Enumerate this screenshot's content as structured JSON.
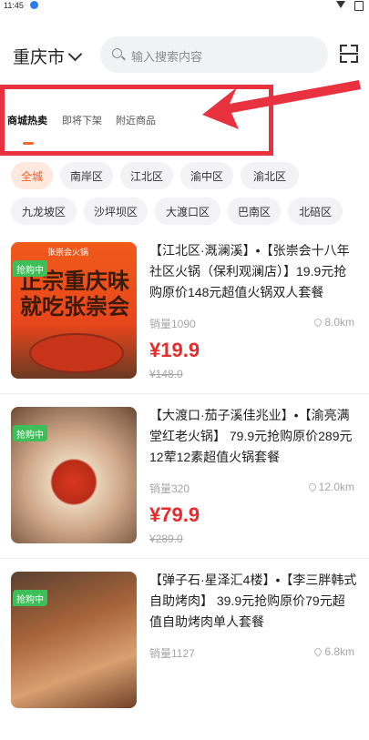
{
  "status_bar": {
    "time": "11:45"
  },
  "header": {
    "city": "重庆市",
    "search_placeholder": "输入搜索内容"
  },
  "tabs": [
    {
      "label": "商城热卖",
      "active": true
    },
    {
      "label": "即将下架",
      "active": false
    },
    {
      "label": "附近商品",
      "active": false
    }
  ],
  "districts": [
    {
      "label": "全城",
      "active": true
    },
    {
      "label": "南岸区",
      "active": false
    },
    {
      "label": "江北区",
      "active": false
    },
    {
      "label": "渝中区",
      "active": false
    },
    {
      "label": "渝北区",
      "active": false
    },
    {
      "label": "九龙坡区",
      "active": false
    },
    {
      "label": "沙坪坝区",
      "active": false
    },
    {
      "label": "大渡口区",
      "active": false
    },
    {
      "label": "巴南区",
      "active": false
    },
    {
      "label": "北碚区",
      "active": false
    }
  ],
  "products": [
    {
      "title": "【江北区·溉澜溪】•【张崇会十八年社区火锅（保利观澜店）】19.9元抢购原价148元超值火锅双人套餐",
      "image_text_top": "张崇会火锅",
      "image_text_main": "正宗重庆味就吃张崇会",
      "badge": "抢购中",
      "sales": "销量1090",
      "distance": "8.0km",
      "price": "¥19.9",
      "original_price": "¥148.0"
    },
    {
      "title": "【大渡口·茄子溪佳兆业】•【渝亮满堂红老火锅】 79.9元抢购原价289元12荤12素超值火锅套餐",
      "badge": "抢购中",
      "sales": "销量320",
      "distance": "12.0km",
      "price": "¥79.9",
      "original_price": "¥289.0"
    },
    {
      "title": "【弹子石·星泽汇4楼】•【李三胖韩式自助烤肉】 39.9元抢购原价79元超值自助烤肉单人套餐",
      "badge": "抢购中",
      "sales": "销量1127",
      "distance": "6.8km",
      "price": "",
      "original_price": ""
    }
  ],
  "colors": {
    "accent": "#ff5a1f",
    "price": "#e82a2a",
    "badge": "#3cbe58",
    "highlight_box": "#e8323f"
  }
}
